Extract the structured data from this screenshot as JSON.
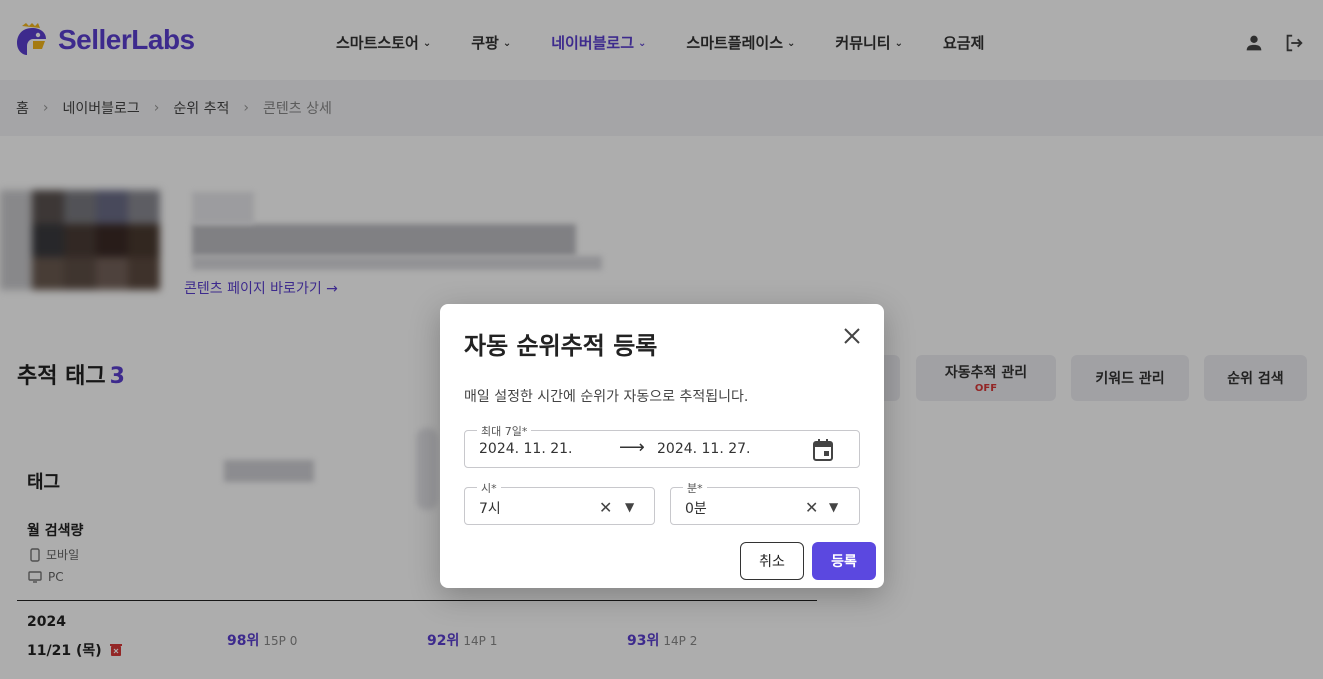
{
  "header": {
    "logo_text": "SellerLabs",
    "nav": [
      {
        "label": "스마트스토어",
        "chevron": true,
        "active": false
      },
      {
        "label": "쿠팡",
        "chevron": true,
        "active": false
      },
      {
        "label": "네이버블로그",
        "chevron": true,
        "active": true
      },
      {
        "label": "스마트플레이스",
        "chevron": true,
        "active": false
      },
      {
        "label": "커뮤니티",
        "chevron": true,
        "active": false
      },
      {
        "label": "요금제",
        "chevron": false,
        "active": false
      }
    ],
    "icons": [
      "user-icon",
      "logout-icon"
    ]
  },
  "breadcrumb": [
    "홈",
    "네이버블로그",
    "순위 추적",
    "콘텐츠 상세"
  ],
  "content": {
    "link_label": "콘텐츠 페이지 바로가기",
    "track_title": "추적 태그",
    "track_count": "3",
    "buttons": {
      "auto_track": "자동추적 관리",
      "auto_track_status": "OFF",
      "keyword": "키워드 관리",
      "rank_search": "순위 검색"
    }
  },
  "table": {
    "tag_header": "태그",
    "volume_label": "월 검색량",
    "mobile_label": "모바일",
    "pc_label": "PC",
    "row": {
      "year": "2024",
      "date": "11/21 (목)",
      "ranks": [
        {
          "rank": "98위",
          "sub": "15P 0"
        },
        {
          "rank": "92위",
          "sub": "14P 1"
        },
        {
          "rank": "93위",
          "sub": "14P 2"
        }
      ]
    }
  },
  "modal": {
    "title": "자동 순위추적 등록",
    "description": "매일 설정한 시간에 순위가 자동으로 추적됩니다.",
    "date_label": "최대 7일*",
    "start_date": "2024. 11. 21.",
    "end_date": "2024. 11. 27.",
    "hour_label": "시*",
    "hour_value": "7시",
    "minute_label": "분*",
    "minute_value": "0분",
    "cancel_label": "취소",
    "submit_label": "등록"
  },
  "colors": {
    "brand": "#5b3fd0",
    "submit": "#5b48e0",
    "off": "#d93838"
  }
}
